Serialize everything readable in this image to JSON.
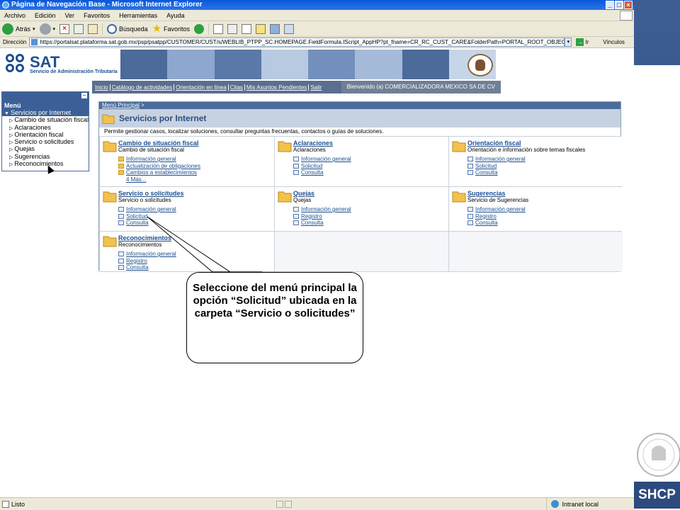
{
  "window": {
    "title": "Página de Navegación Base - Microsoft Internet Explorer"
  },
  "menubar": {
    "items": [
      "Archivo",
      "Edición",
      "Ver",
      "Favoritos",
      "Herramientas",
      "Ayuda"
    ]
  },
  "toolbar": {
    "back_label": "Atrás",
    "search_label": "Búsqueda",
    "favorites_label": "Favoritos"
  },
  "address": {
    "label": "Dirección",
    "url": "https://portalsat.plataforma.sat.gob.mx/psp/psatpp/CUSTOMER/CUST/s/WEBLIB_PTPP_SC.HOMEPAGE.FieldFormula.IScript_AppHP?pt_fname=CR_RC_CUST_CARE&FolderPath=PORTAL_ROOT_OBJECT.CR_RC_CUST_C",
    "go_label": "Ir",
    "links_label": "Vínculos"
  },
  "header": {
    "logo_text": "SAT",
    "logo_subtitle": "Servicio de Administración Tributaria",
    "nav_links": [
      "Inicio",
      "Catálogo de actividades",
      "Orientación en línea",
      "Citas",
      "Mis Asuntos Pendientes",
      "Salir"
    ],
    "welcome": "Bienvenido (a) COMERCIALIZADORA MEXICO SA DE CV"
  },
  "leftmenu": {
    "title": "Menú",
    "top_item": "Servicios por Internet",
    "items": [
      "Cambio de situación fiscal",
      "Aclaraciones",
      "Orientación fiscal",
      "Servicio o solicitudes",
      "Quejas",
      "Sugerencias",
      "Reconocimientos"
    ]
  },
  "main": {
    "breadcrumb": "Menú Principal",
    "breadcrumb_sep": " >",
    "title": "Servicios por Internet",
    "description": "Permite gestionar casos, localizar soluciones, consultar preguntas frecuentas, contactos o guías de soluciones.",
    "cells": [
      {
        "title": "Cambio de situación fiscal",
        "subtitle": "Cambio de situación fiscal",
        "links": [
          "Información general",
          "Actualización de obligaciones",
          "Cambios a establecimientos",
          "4 Más..."
        ]
      },
      {
        "title": "Aclaraciones",
        "subtitle": "Aclaraciones",
        "links": [
          "Información general",
          "Solicitud",
          "Consulta"
        ]
      },
      {
        "title": "Orientación fiscal",
        "subtitle": "Orientación e información sobre temas fiscales",
        "links": [
          "Información general",
          "Solicitud",
          "Consulta"
        ]
      },
      {
        "title": "Servicio o solicitudes",
        "subtitle": "Servicio o solicitudes",
        "links": [
          "Información general",
          "Solicitud",
          "Consulta"
        ]
      },
      {
        "title": "Quejas",
        "subtitle": "Quejas",
        "links": [
          "Información general",
          "Registro",
          "Consulta"
        ]
      },
      {
        "title": "Sugerencias",
        "subtitle": "Servicio de Sugerencias",
        "links": [
          "Información general",
          "Registro",
          "Consulta"
        ]
      },
      {
        "title": "Reconocimientos",
        "subtitle": "Reconocimientos",
        "links": [
          "Información general",
          "Registro",
          "Consulta"
        ]
      }
    ]
  },
  "callout": {
    "text": "Seleccione del menú principal la opción “Solicitud” ubicada en la carpeta “Servicio o solicitudes”"
  },
  "statusbar": {
    "status": "Listo",
    "zone": "Intranet local"
  },
  "slide": {
    "brand": "SHCP"
  }
}
